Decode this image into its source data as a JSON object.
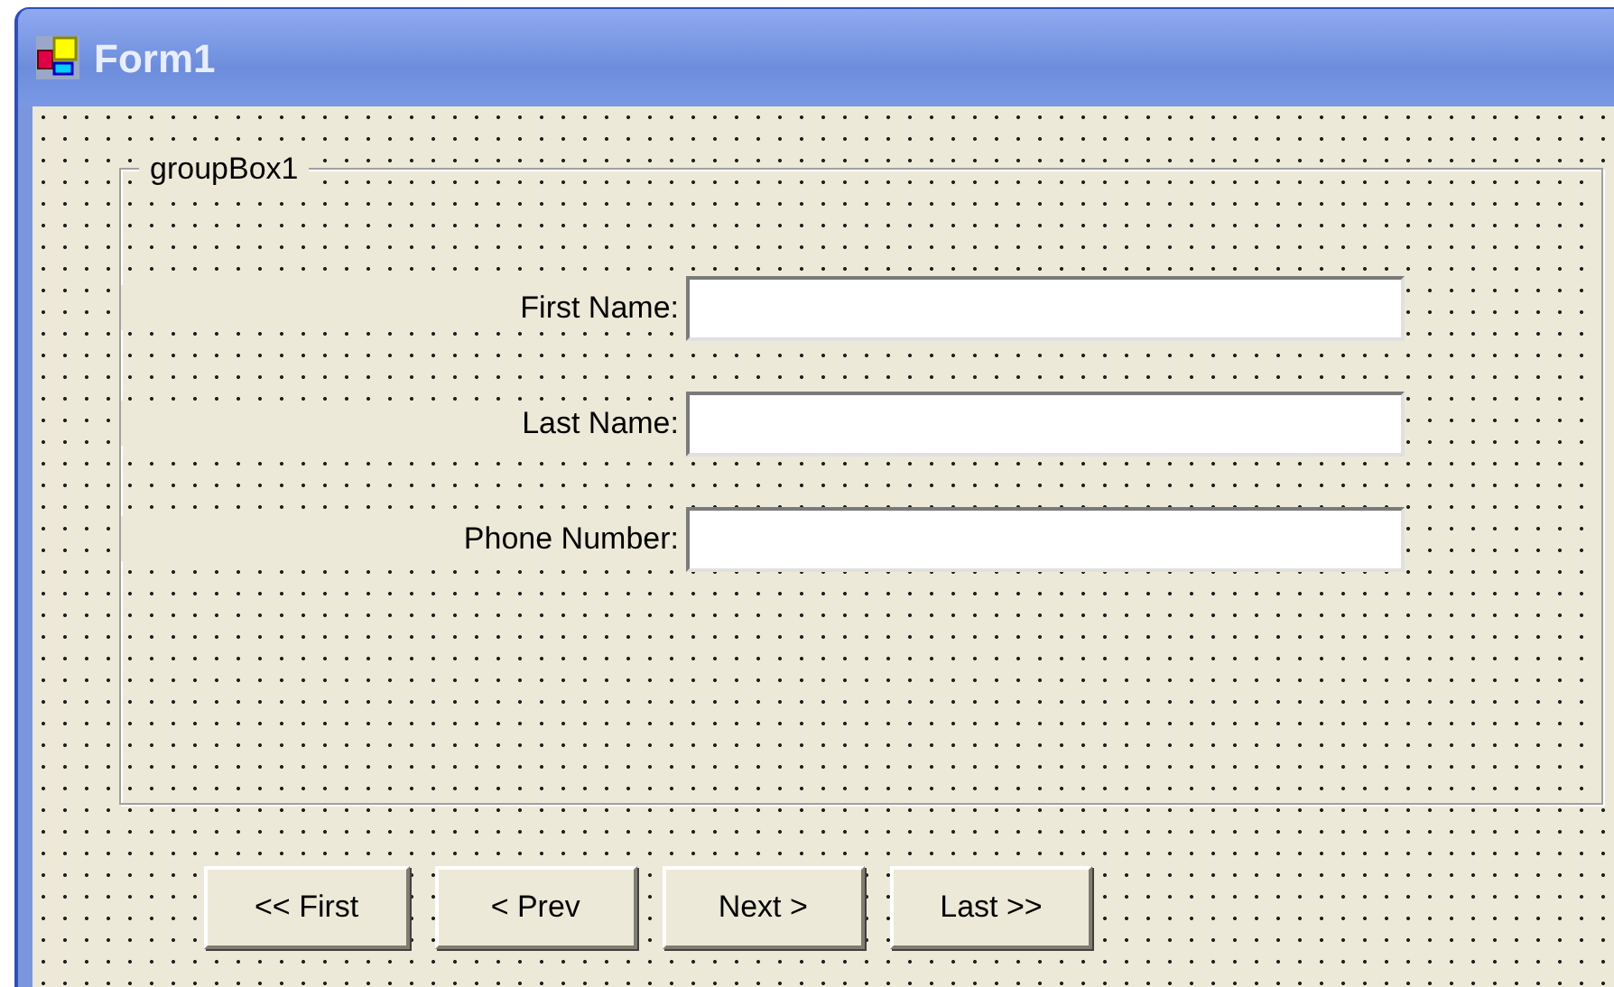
{
  "window": {
    "title": "Form1"
  },
  "group_box": {
    "title": "groupBox1",
    "fields": [
      {
        "label": "First Name:"
      },
      {
        "label": "Last Name:"
      },
      {
        "label": "Phone Number:"
      }
    ]
  },
  "buttons": [
    {
      "label": "<< First"
    },
    {
      "label": "< Prev"
    },
    {
      "label": "Next >"
    },
    {
      "label": "Last >>"
    }
  ]
}
